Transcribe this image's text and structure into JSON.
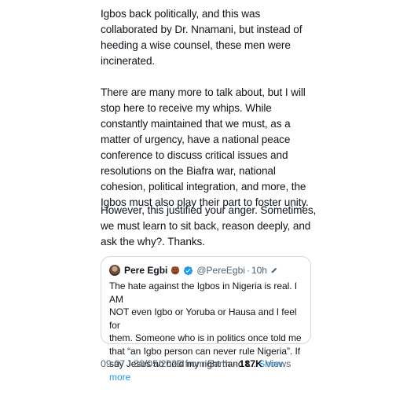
{
  "tweet": {
    "paragraphs": [
      "Igbos back politically, and this was\ncollaborated by Dr. Nnamani, but instead of\nheeding a wise counsel, these men were\nincinerated.",
      "There are many more to talk about, but I will\nstop here to receive my whips. While\nconstantly maintained that we must, as a\nmatter of urgency, have a national peace\nconference to discuss critical issues and\nresolutions on the Biafra war, national\ncohesion, political integration, and more, the\nIgbos must also play their part to foster unity.",
      "However, this justified your anger. Sometimes,\nwe must learn to sit back, reason deeply, and\nask the why?. Thanks."
    ],
    "meta": {
      "time": "09:07",
      "separator": "·",
      "date": "30/05/2023",
      "source": "from Earth",
      "views_count": "187K",
      "views_label": "Views"
    }
  },
  "quote": {
    "name": "Pere Egbi",
    "handle": "@PereEgbi",
    "time": "10h",
    "separator": "·",
    "text_lines": [
      "The hate against the Igbos in Nigeria is real. I AM",
      "NOT even Igbo or Yoruba or Hausa and I feel for",
      "them. Someone who is in politics once told me",
      "that “an Igbo person can never rule Nigeria”. If",
      "say Jesus no hold my right hand t..."
    ],
    "show_more": "Show more",
    "icons": {
      "avatar": "avatar",
      "emoji": "face-emoji-icon",
      "verified": "verified-badge-icon",
      "edit": "edit-pencil-icon"
    }
  },
  "colors": {
    "text": "#0f1419",
    "secondary": "#536471",
    "link": "#1d9bf0",
    "border": "#cfd9de"
  }
}
